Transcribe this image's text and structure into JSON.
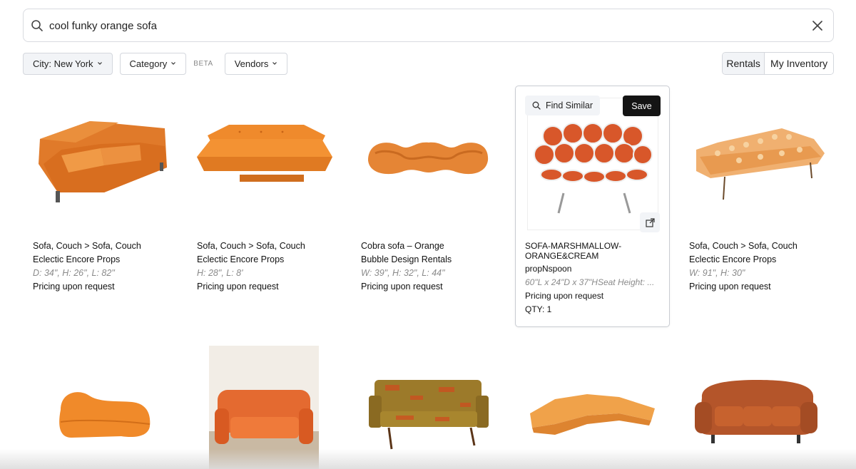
{
  "search": {
    "query": "cool funky orange sofa"
  },
  "filters": {
    "city_label": "City: New York",
    "category_label": "Category",
    "beta_badge": "BETA",
    "vendors_label": "Vendors"
  },
  "view_toggle": {
    "rentals": "Rentals",
    "inventory": "My Inventory"
  },
  "hover_card": {
    "find_similar": "Find Similar",
    "save": "Save"
  },
  "products": [
    {
      "category": "Sofa, Couch > Sofa, Couch",
      "vendor": "Eclectic Encore Props",
      "dims": "D: 34\", H: 26\", L: 82\"",
      "price": "Pricing upon request"
    },
    {
      "category": "Sofa, Couch > Sofa, Couch",
      "vendor": "Eclectic Encore Props",
      "dims": "H: 28\", L: 8'",
      "price": "Pricing upon request"
    },
    {
      "category": "Cobra sofa – Orange",
      "vendor": "Bubble Design Rentals",
      "dims": "W: 39\", H: 32\", L: 44\"",
      "price": "Pricing upon request"
    },
    {
      "category": "SOFA-MARSHMALLOW-ORANGE&CREAM",
      "vendor": "propNspoon",
      "dims": "60\"L x 24\"D x 37\"HSeat Height: ...",
      "price": "Pricing upon request",
      "qty": "QTY: 1"
    },
    {
      "category": "Sofa, Couch > Sofa, Couch",
      "vendor": "Eclectic Encore Props",
      "dims": "W: 91\", H: 30\"",
      "price": "Pricing upon request"
    }
  ],
  "colors": {
    "accent_dark": "#141414",
    "sofa_orange": "#e8832a",
    "muted_text": "#8a8a8a"
  }
}
